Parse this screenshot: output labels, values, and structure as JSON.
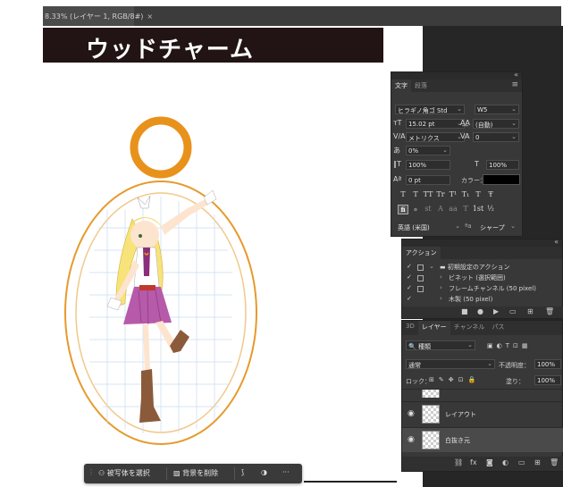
{
  "document_tab": {
    "title": "8.33% (レイヤー 1, RGB/8#)",
    "close": "×"
  },
  "banner": {
    "text": "ウッドチャーム"
  },
  "character_panel": {
    "tabs": [
      "文字",
      "段落"
    ],
    "font_family": "ヒラギノ角ゴ Std",
    "font_style": "W5",
    "font_size": "15.02 pt",
    "leading": "(自動)",
    "kerning": "メトリクス",
    "tracking": "0",
    "tsume": "0%",
    "vertical_scale": "100%",
    "horizontal_scale": "100%",
    "baseline_shift": "0 pt",
    "color_label": "カラー：",
    "style_buttons": [
      "T",
      "T",
      "TT",
      "Tr",
      "T¹",
      "T₁",
      "T",
      "Ŧ"
    ],
    "opentype_buttons": [
      "ﬁ",
      "ℴ",
      "st",
      "A",
      "aa",
      "T",
      "1st",
      "½"
    ],
    "language": "英語 (米国)",
    "antialias": "シャープ",
    "accent_color": "#000000"
  },
  "actions_panel": {
    "tab": "アクション",
    "items": [
      {
        "arrow": "⌄",
        "label": "初期設定のアクション"
      },
      {
        "arrow": "›",
        "label": "ビネット (選択範囲)"
      },
      {
        "arrow": "›",
        "label": "フレームチャンネル (50 pixel)"
      },
      {
        "arrow": "›",
        "label": "木製 (50 pixel)"
      }
    ]
  },
  "layers_panel": {
    "tabs": [
      "3D",
      "レイヤー",
      "チャンネル",
      "パス"
    ],
    "filter": "種類",
    "blend_mode": "通常",
    "opacity_label": "不透明度：",
    "opacity": "100%",
    "lock_label": "ロック：",
    "fill_label": "塗り：",
    "fill": "100%",
    "layers": [
      {
        "name": "レイアウト",
        "selected": false
      },
      {
        "name": "白抜き元",
        "selected": true
      }
    ]
  },
  "taskbar": {
    "select_subject": "被写体を選択",
    "remove_background": "背景を削除",
    "more": "···"
  }
}
